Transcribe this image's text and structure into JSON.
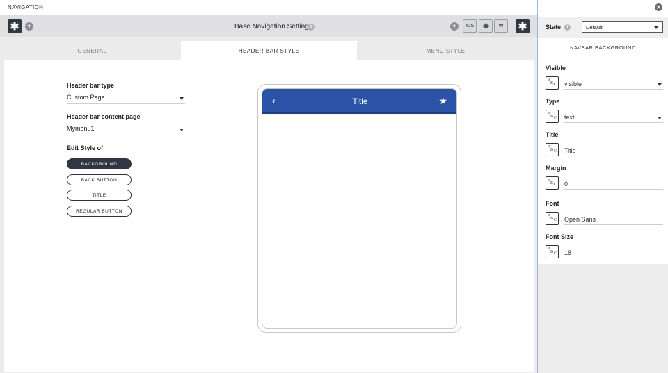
{
  "window": {
    "title": "NAVIGATION"
  },
  "toolbar": {
    "title": "Base Navigation Settings",
    "left_icon": "asterisk-icon",
    "add_icon": "plus-circle-icon",
    "platform_buttons": [
      "IOS",
      "android-icon",
      "W"
    ],
    "right_icon": "asterisk-icon"
  },
  "tabs": [
    {
      "label": "GENERAL",
      "active": false
    },
    {
      "label": "HEADER BAR STYLE",
      "active": true
    },
    {
      "label": "MENU STYLE",
      "active": false
    }
  ],
  "form": {
    "header_bar_type_label": "Header bar type",
    "header_bar_type_value": "Custom Page",
    "content_page_label": "Header bar content page",
    "content_page_value": "Mymenu1",
    "edit_style_label": "Edit Style of",
    "style_buttons": [
      "BACKGROUND",
      "BACK BUTTON",
      "TITLE",
      "REGULAR BUTTON"
    ],
    "active_style": "BACKGROUND"
  },
  "preview": {
    "navbar_title": "Title",
    "navbar_color": "#2a53a8",
    "back_icon": "chevron-left-icon",
    "action_icon": "star-icon"
  },
  "panel": {
    "state_label": "State",
    "state_value": "Default",
    "section_title": "NAVBAR BACKGROUND",
    "properties": [
      {
        "label": "Visible",
        "value": "visible",
        "dropdown": true
      },
      {
        "label": "Type",
        "value": "text",
        "dropdown": true
      },
      {
        "label": "Title",
        "value": "Title",
        "dropdown": false
      },
      {
        "label": "Margin",
        "value": "0",
        "dropdown": false
      },
      {
        "label": "Font",
        "value": "Open Sans",
        "dropdown": false
      },
      {
        "label": "Font Size",
        "value": "18",
        "dropdown": false
      }
    ]
  },
  "colors": {
    "dark_button": "#2f3742",
    "accent_border": "#9cb5dc"
  }
}
